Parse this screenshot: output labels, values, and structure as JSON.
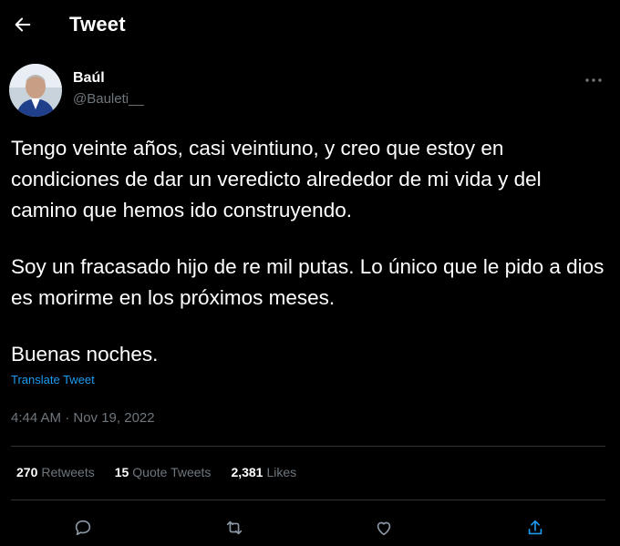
{
  "header": {
    "title": "Tweet",
    "back_icon": "arrow-left-icon"
  },
  "author": {
    "name": "Baúl",
    "handle": "@Bauleti__",
    "more_icon": "more-icon"
  },
  "tweet": {
    "paragraphs": [
      "Tengo veinte años, casi veintiuno, y creo que estoy en condiciones de dar un veredicto alrededor de mi vida y del camino que hemos ido construyendo.",
      "Soy un fracasado hijo de re mil putas. Lo único que le pido a dios es morirme en los próximos meses.",
      "Buenas noches."
    ],
    "translate_label": "Translate Tweet",
    "timestamp": "4:44 AM · Nov 19, 2022"
  },
  "stats": {
    "retweets_count": "270",
    "retweets_label": "Retweets",
    "quotes_count": "15",
    "quotes_label": "Quote Tweets",
    "likes_count": "2,381",
    "likes_label": "Likes"
  },
  "actions": [
    "reply-icon",
    "retweet-icon",
    "like-icon",
    "share-icon"
  ],
  "colors": {
    "background": "#000000",
    "text": "#ffffff",
    "secondary": "#6e767d",
    "accent": "#1d9bf0",
    "divider": "#2f3336"
  }
}
